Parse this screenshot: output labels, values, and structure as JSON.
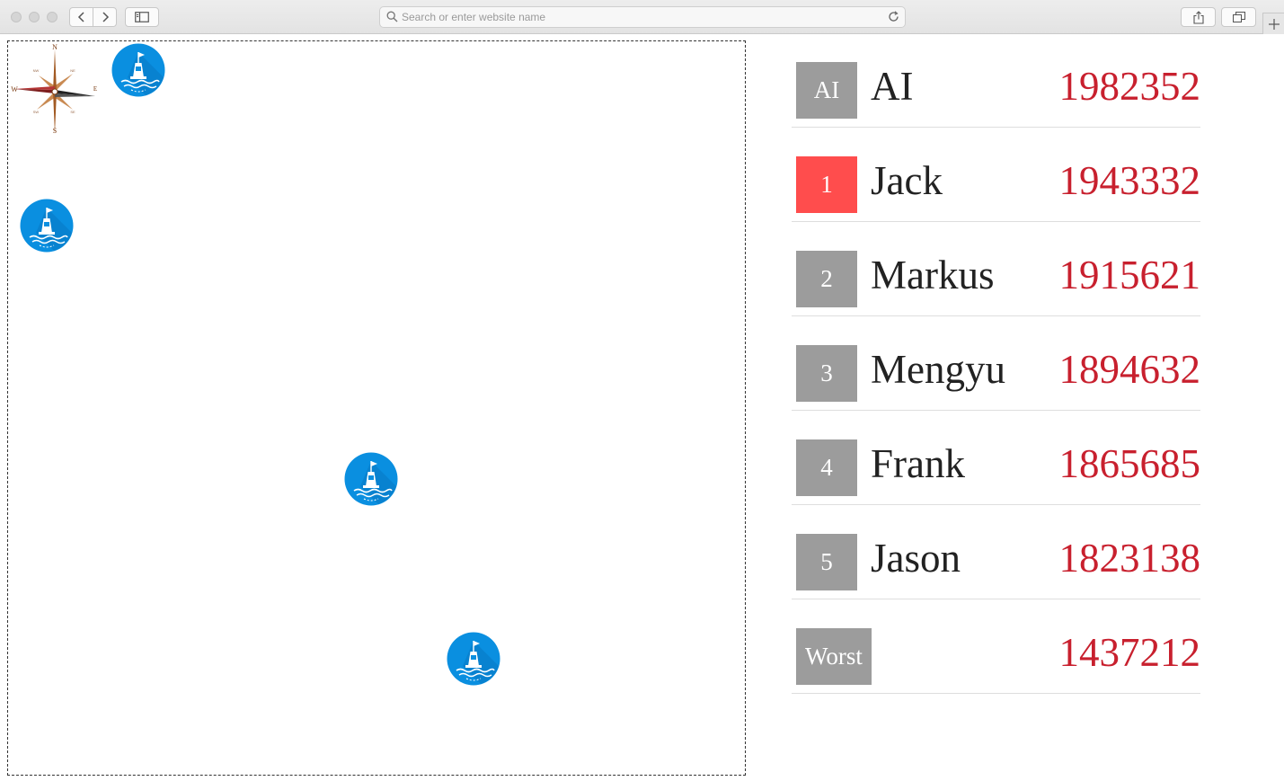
{
  "browser": {
    "address_placeholder": "Search or enter website name"
  },
  "board": {
    "compass_labels": {
      "n": "N",
      "s": "S",
      "e": "E",
      "w": "W",
      "nw": "NW",
      "ne": "NE",
      "sw": "SW",
      "se": "SE"
    },
    "buoy_icon": "buoy-icon",
    "buoy_color": "#0a8fe0"
  },
  "leaderboard": {
    "rows": [
      {
        "badge": "AI",
        "name": "AI",
        "score": "1982352",
        "highlighted": false
      },
      {
        "badge": "1",
        "name": "Jack",
        "score": "1943332",
        "highlighted": true
      },
      {
        "badge": "2",
        "name": "Markus",
        "score": "1915621",
        "highlighted": false
      },
      {
        "badge": "3",
        "name": "Mengyu",
        "score": "1894632",
        "highlighted": false
      },
      {
        "badge": "4",
        "name": "Frank",
        "score": "1865685",
        "highlighted": false
      },
      {
        "badge": "5",
        "name": "Jason",
        "score": "1823138",
        "highlighted": false
      },
      {
        "badge": "Worst",
        "name": "",
        "score": "1437212",
        "highlighted": false
      }
    ],
    "colors": {
      "badge": "#9c9c9c",
      "badge_highlight": "#ff4d4d",
      "score": "#c8202e"
    }
  }
}
